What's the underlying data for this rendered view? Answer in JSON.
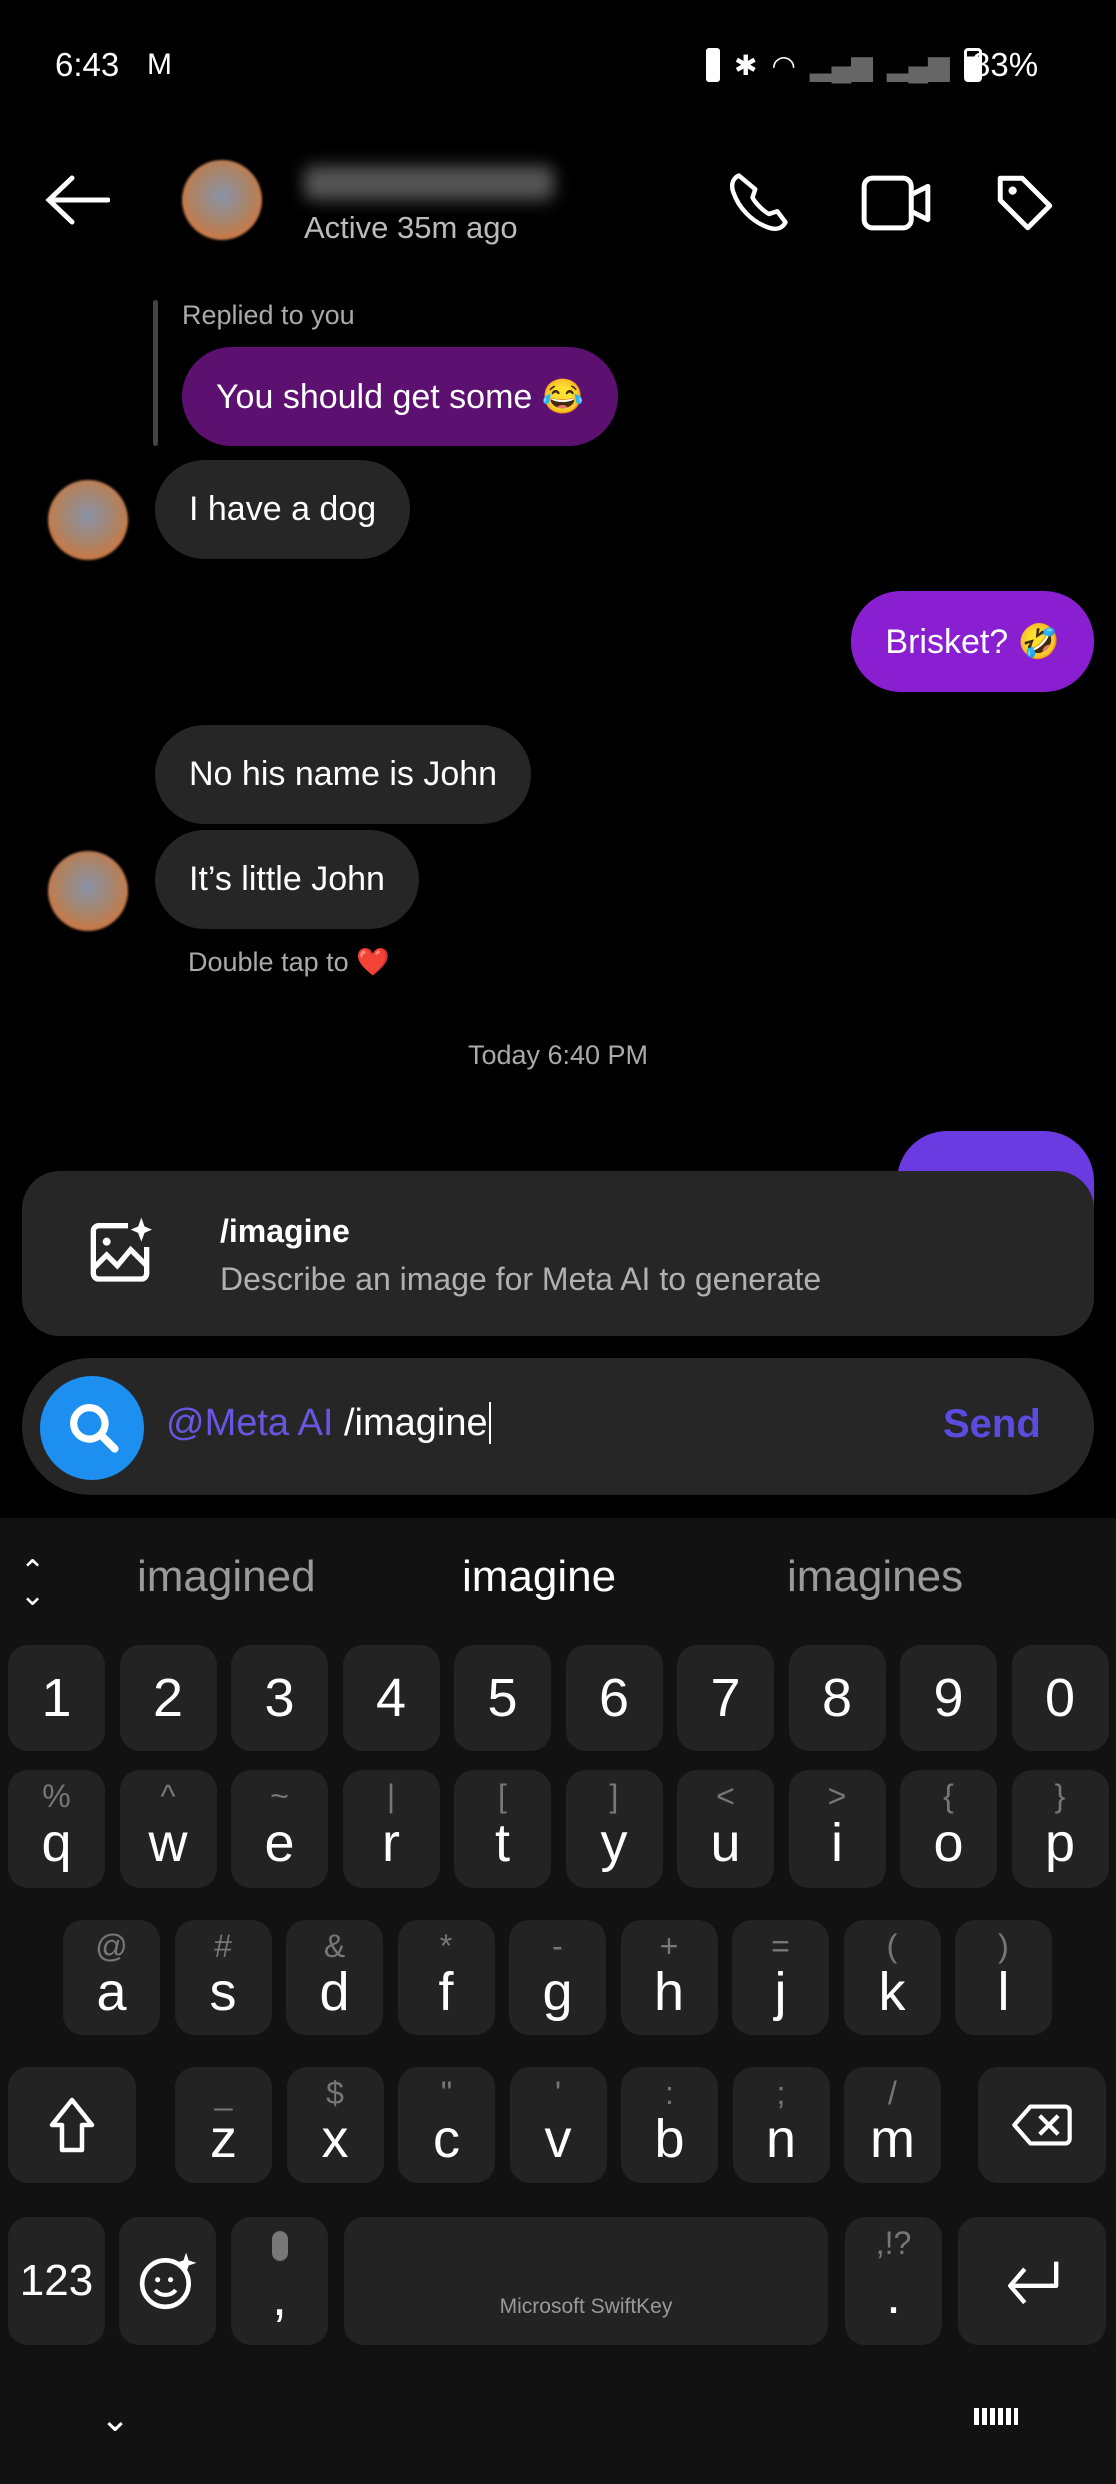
{
  "status_bar": {
    "time": "6:43",
    "battery": "83%",
    "icons": [
      "gmail-icon",
      "vibrate-icon",
      "bluetooth-icon",
      "wifi-icon",
      "signal-icon",
      "signal-icon",
      "battery-icon"
    ]
  },
  "header": {
    "active_status": "Active 35m ago",
    "icons": [
      "back-arrow-icon",
      "phone-icon",
      "video-icon",
      "tag-icon"
    ]
  },
  "messages": [
    {
      "reply_label": "Replied to you",
      "text": "You should get some 😂",
      "from": "me-reply"
    },
    {
      "text": "I have a dog",
      "from": "them"
    },
    {
      "text": "Brisket? 🤣",
      "from": "me"
    },
    {
      "text": "No his name is John",
      "from": "them"
    },
    {
      "text": "It’s little John",
      "from": "them"
    }
  ],
  "hint": {
    "text": "Double tap to",
    "emoji": "❤️"
  },
  "timestamp": "Today 6:40 PM",
  "colors": {
    "reply_bubble": "#5c106f",
    "sent_bubble": "#8a1fd2",
    "meta_accent": "#6a55e0",
    "search_blue": "#1d8ff0"
  },
  "suggestion_popup": {
    "title": "/imagine",
    "description": "Describe an image for Meta AI to generate",
    "icon": "image-sparkle-icon"
  },
  "composer": {
    "mention": "@Meta AI",
    "text": "/imagine",
    "send_label": "Send"
  },
  "keyboard": {
    "suggestions": [
      "imagined",
      "imagine",
      "imagines"
    ],
    "numbers": [
      "1",
      "2",
      "3",
      "4",
      "5",
      "6",
      "7",
      "8",
      "9",
      "0"
    ],
    "row1": [
      [
        "q",
        "%"
      ],
      [
        "w",
        "^"
      ],
      [
        "e",
        "~"
      ],
      [
        "r",
        "|"
      ],
      [
        "t",
        "["
      ],
      [
        "y",
        "]"
      ],
      [
        "u",
        "<"
      ],
      [
        "i",
        ">"
      ],
      [
        "o",
        "{"
      ],
      [
        "p",
        "}"
      ]
    ],
    "row2": [
      [
        "a",
        "@"
      ],
      [
        "s",
        "#"
      ],
      [
        "d",
        "&"
      ],
      [
        "f",
        "*"
      ],
      [
        "g",
        "-"
      ],
      [
        "h",
        "+"
      ],
      [
        "j",
        "="
      ],
      [
        "k",
        "("
      ],
      [
        "l",
        ")"
      ]
    ],
    "row3": [
      [
        "z",
        "_"
      ],
      [
        "x",
        "$"
      ],
      [
        "c",
        "\""
      ],
      [
        "v",
        "'"
      ],
      [
        "b",
        ":"
      ],
      [
        "n",
        ";"
      ],
      [
        "m",
        "/"
      ]
    ],
    "num_label": "123",
    "comma": ",",
    "period": ".",
    "period_alt": ",!?",
    "space_label": "Microsoft SwiftKey"
  }
}
